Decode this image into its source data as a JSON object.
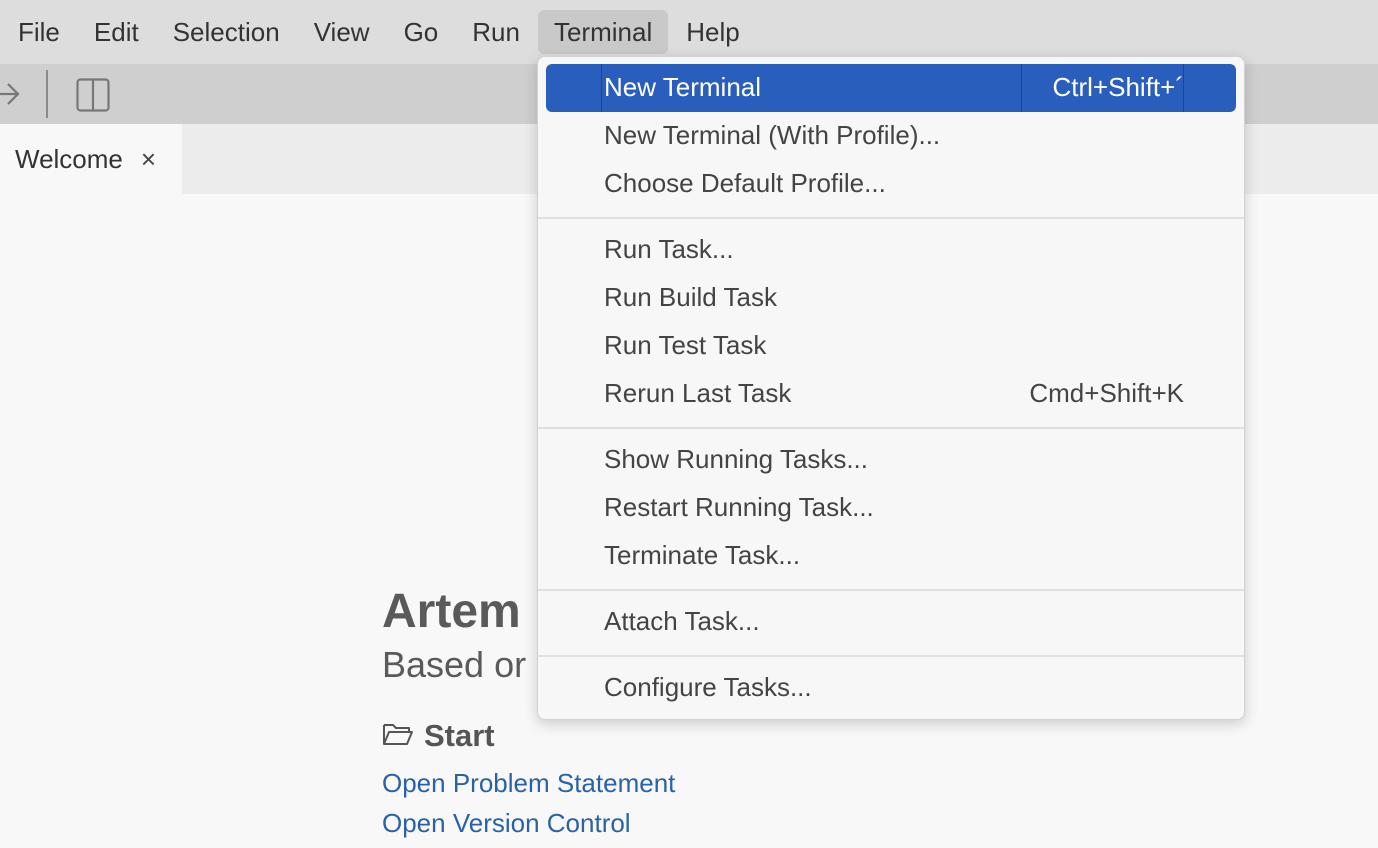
{
  "menubar": {
    "items": [
      {
        "label": "File",
        "active": false
      },
      {
        "label": "Edit",
        "active": false
      },
      {
        "label": "Selection",
        "active": false
      },
      {
        "label": "View",
        "active": false
      },
      {
        "label": "Go",
        "active": false
      },
      {
        "label": "Run",
        "active": false
      },
      {
        "label": "Terminal",
        "active": true
      },
      {
        "label": "Help",
        "active": false
      }
    ]
  },
  "toolbar": {
    "icons": [
      "arrow-right-icon",
      "split-editor-icon"
    ]
  },
  "tabs": [
    {
      "label": "Welcome",
      "close_glyph": "×"
    }
  ],
  "welcome": {
    "title": "Artem",
    "subtitle": "Based or",
    "start_heading": "Start",
    "links": [
      "Open Problem Statement",
      "Open Version Control"
    ]
  },
  "terminal_menu": {
    "groups": [
      [
        {
          "label": "New Terminal",
          "shortcut": "Ctrl+Shift+´",
          "highlighted": true
        },
        {
          "label": "New Terminal (With Profile)...",
          "shortcut": ""
        },
        {
          "label": "Choose Default Profile...",
          "shortcut": ""
        }
      ],
      [
        {
          "label": "Run Task...",
          "shortcut": ""
        },
        {
          "label": "Run Build Task",
          "shortcut": ""
        },
        {
          "label": "Run Test Task",
          "shortcut": ""
        },
        {
          "label": "Rerun Last Task",
          "shortcut": "Cmd+Shift+K"
        }
      ],
      [
        {
          "label": "Show Running Tasks...",
          "shortcut": ""
        },
        {
          "label": "Restart Running Task...",
          "shortcut": ""
        },
        {
          "label": "Terminate Task...",
          "shortcut": ""
        }
      ],
      [
        {
          "label": "Attach Task...",
          "shortcut": ""
        }
      ],
      [
        {
          "label": "Configure Tasks...",
          "shortcut": ""
        }
      ]
    ]
  },
  "colors": {
    "highlight": "#2a5ebd",
    "link": "#2a62a8",
    "menubar": "#dddddd"
  }
}
